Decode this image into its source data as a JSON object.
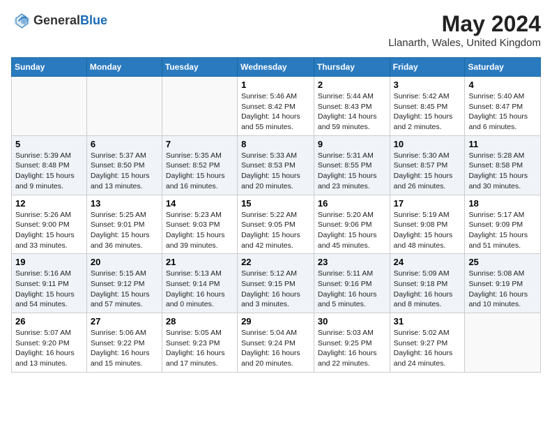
{
  "header": {
    "logo_general": "General",
    "logo_blue": "Blue",
    "month_year": "May 2024",
    "location": "Llanarth, Wales, United Kingdom"
  },
  "days_of_week": [
    "Sunday",
    "Monday",
    "Tuesday",
    "Wednesday",
    "Thursday",
    "Friday",
    "Saturday"
  ],
  "weeks": [
    [
      {
        "day": "",
        "content": ""
      },
      {
        "day": "",
        "content": ""
      },
      {
        "day": "",
        "content": ""
      },
      {
        "day": "1",
        "content": "Sunrise: 5:46 AM\nSunset: 8:42 PM\nDaylight: 14 hours and 55 minutes."
      },
      {
        "day": "2",
        "content": "Sunrise: 5:44 AM\nSunset: 8:43 PM\nDaylight: 14 hours and 59 minutes."
      },
      {
        "day": "3",
        "content": "Sunrise: 5:42 AM\nSunset: 8:45 PM\nDaylight: 15 hours and 2 minutes."
      },
      {
        "day": "4",
        "content": "Sunrise: 5:40 AM\nSunset: 8:47 PM\nDaylight: 15 hours and 6 minutes."
      }
    ],
    [
      {
        "day": "5",
        "content": "Sunrise: 5:39 AM\nSunset: 8:48 PM\nDaylight: 15 hours and 9 minutes."
      },
      {
        "day": "6",
        "content": "Sunrise: 5:37 AM\nSunset: 8:50 PM\nDaylight: 15 hours and 13 minutes."
      },
      {
        "day": "7",
        "content": "Sunrise: 5:35 AM\nSunset: 8:52 PM\nDaylight: 15 hours and 16 minutes."
      },
      {
        "day": "8",
        "content": "Sunrise: 5:33 AM\nSunset: 8:53 PM\nDaylight: 15 hours and 20 minutes."
      },
      {
        "day": "9",
        "content": "Sunrise: 5:31 AM\nSunset: 8:55 PM\nDaylight: 15 hours and 23 minutes."
      },
      {
        "day": "10",
        "content": "Sunrise: 5:30 AM\nSunset: 8:57 PM\nDaylight: 15 hours and 26 minutes."
      },
      {
        "day": "11",
        "content": "Sunrise: 5:28 AM\nSunset: 8:58 PM\nDaylight: 15 hours and 30 minutes."
      }
    ],
    [
      {
        "day": "12",
        "content": "Sunrise: 5:26 AM\nSunset: 9:00 PM\nDaylight: 15 hours and 33 minutes."
      },
      {
        "day": "13",
        "content": "Sunrise: 5:25 AM\nSunset: 9:01 PM\nDaylight: 15 hours and 36 minutes."
      },
      {
        "day": "14",
        "content": "Sunrise: 5:23 AM\nSunset: 9:03 PM\nDaylight: 15 hours and 39 minutes."
      },
      {
        "day": "15",
        "content": "Sunrise: 5:22 AM\nSunset: 9:05 PM\nDaylight: 15 hours and 42 minutes."
      },
      {
        "day": "16",
        "content": "Sunrise: 5:20 AM\nSunset: 9:06 PM\nDaylight: 15 hours and 45 minutes."
      },
      {
        "day": "17",
        "content": "Sunrise: 5:19 AM\nSunset: 9:08 PM\nDaylight: 15 hours and 48 minutes."
      },
      {
        "day": "18",
        "content": "Sunrise: 5:17 AM\nSunset: 9:09 PM\nDaylight: 15 hours and 51 minutes."
      }
    ],
    [
      {
        "day": "19",
        "content": "Sunrise: 5:16 AM\nSunset: 9:11 PM\nDaylight: 15 hours and 54 minutes."
      },
      {
        "day": "20",
        "content": "Sunrise: 5:15 AM\nSunset: 9:12 PM\nDaylight: 15 hours and 57 minutes."
      },
      {
        "day": "21",
        "content": "Sunrise: 5:13 AM\nSunset: 9:14 PM\nDaylight: 16 hours and 0 minutes."
      },
      {
        "day": "22",
        "content": "Sunrise: 5:12 AM\nSunset: 9:15 PM\nDaylight: 16 hours and 3 minutes."
      },
      {
        "day": "23",
        "content": "Sunrise: 5:11 AM\nSunset: 9:16 PM\nDaylight: 16 hours and 5 minutes."
      },
      {
        "day": "24",
        "content": "Sunrise: 5:09 AM\nSunset: 9:18 PM\nDaylight: 16 hours and 8 minutes."
      },
      {
        "day": "25",
        "content": "Sunrise: 5:08 AM\nSunset: 9:19 PM\nDaylight: 16 hours and 10 minutes."
      }
    ],
    [
      {
        "day": "26",
        "content": "Sunrise: 5:07 AM\nSunset: 9:20 PM\nDaylight: 16 hours and 13 minutes."
      },
      {
        "day": "27",
        "content": "Sunrise: 5:06 AM\nSunset: 9:22 PM\nDaylight: 16 hours and 15 minutes."
      },
      {
        "day": "28",
        "content": "Sunrise: 5:05 AM\nSunset: 9:23 PM\nDaylight: 16 hours and 17 minutes."
      },
      {
        "day": "29",
        "content": "Sunrise: 5:04 AM\nSunset: 9:24 PM\nDaylight: 16 hours and 20 minutes."
      },
      {
        "day": "30",
        "content": "Sunrise: 5:03 AM\nSunset: 9:25 PM\nDaylight: 16 hours and 22 minutes."
      },
      {
        "day": "31",
        "content": "Sunrise: 5:02 AM\nSunset: 9:27 PM\nDaylight: 16 hours and 24 minutes."
      },
      {
        "day": "",
        "content": ""
      }
    ]
  ]
}
